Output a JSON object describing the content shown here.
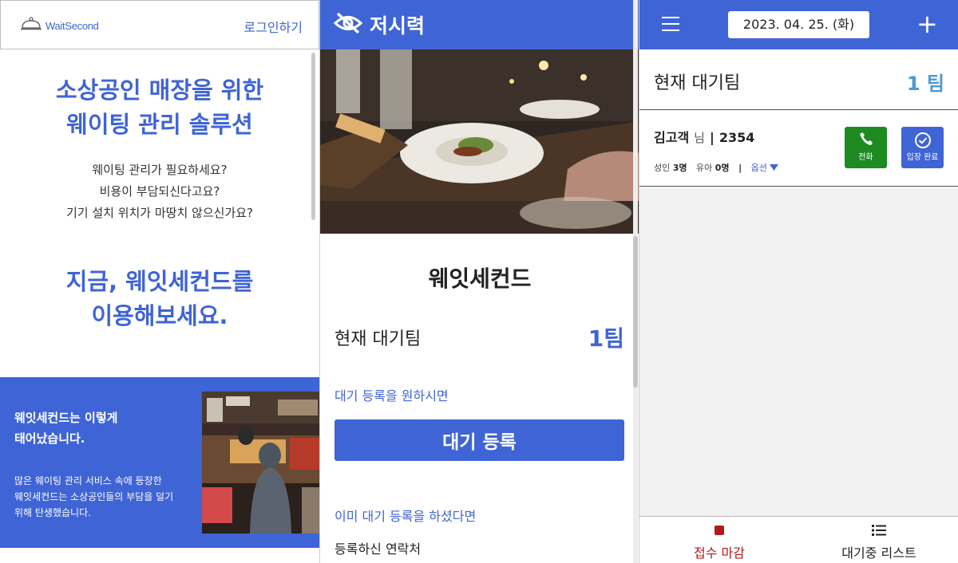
{
  "landing": {
    "logo_text": "WaitSecond",
    "login_label": "로그인하기",
    "hero_title_line1": "소상공인 매장을 위한",
    "hero_title_line2": "웨이팅 관리 솔루션",
    "hero_lines": [
      "웨이팅 관리가 필요하세요?",
      "비용이 부담되신다고요?",
      "기기 설치 위치가 마땅치 않으신가요?"
    ],
    "cta_line1": "지금, 웨잇세컨드를",
    "cta_line2": "이용해보세요.",
    "story_title_line1": "웨잇세컨드는 이렇게",
    "story_title_line2": "태어났습니다.",
    "story_body_line1": "많은 웨이팅 관리 서비스 속에 등장한",
    "story_body_line2": "웨잇세컨드는 소상공인들의 부담을 덜기",
    "story_body_line3": "위해 탄생했습니다."
  },
  "store": {
    "name": "저시력",
    "title": "웨잇세컨드",
    "wait_label": "현재 대기팀",
    "wait_count": "1팀",
    "register_prompt": "대기 등록을 원하시면",
    "register_button": "대기 등록",
    "already_prompt": "이미 대기 등록을 하셨다면",
    "contact_label": "등록하신 연락처"
  },
  "admin": {
    "date": "2023. 04. 25. (화)",
    "plus_symbol": "+",
    "wait_label": "현재 대기팀",
    "wait_count": "1 팀",
    "guest": {
      "name": "김고객",
      "suffix": "님",
      "separator": "|",
      "number": "2354",
      "adult_label": "성인",
      "adult_count": "3명",
      "child_label": "유아",
      "child_count": "0명",
      "detail_separator": "|",
      "option_label": "옵션"
    },
    "call_label": "전화",
    "done_label": "입장 완료",
    "tab_close_label": "접수 마감",
    "tab_list_label": "대기중 리스트"
  },
  "colors": {
    "brand_blue": "#3f64d6",
    "call_green": "#1d8a22",
    "close_red": "#b21a1a",
    "count_blue": "#4a9ad6"
  },
  "icons": {
    "logo": "cloche-icon",
    "store": "eye-slash-icon",
    "menu": "hamburger-icon",
    "call": "phone-icon",
    "done": "check-circle-icon",
    "close_tab": "stop-square-icon",
    "list_tab": "list-icon",
    "option": "caret-down-icon"
  }
}
